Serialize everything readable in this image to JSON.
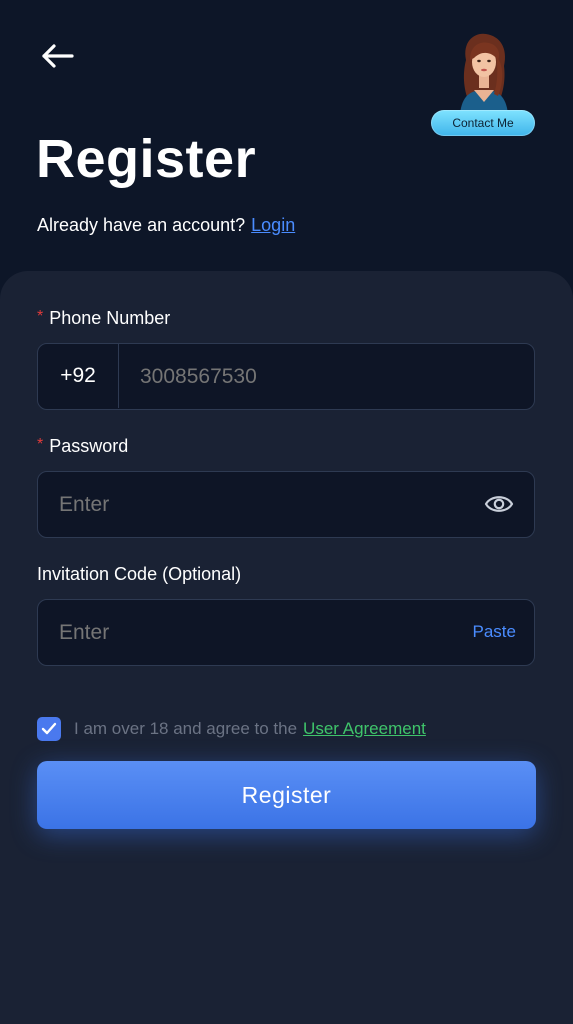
{
  "header": {
    "back_icon": "arrow-left-icon",
    "title": "Register",
    "have_account_text": "Already have an account?",
    "login_link": "Login"
  },
  "contact": {
    "label": "Contact Me"
  },
  "form": {
    "phone": {
      "label": "Phone Number",
      "required_mark": "*",
      "prefix": "+92",
      "placeholder": "3008567530"
    },
    "password": {
      "label": "Password",
      "required_mark": "*",
      "placeholder": "Enter",
      "toggle_icon": "eye-icon"
    },
    "invitation": {
      "label": "Invitation Code (Optional)",
      "placeholder": "Enter",
      "paste_label": "Paste"
    },
    "agreement": {
      "checked": true,
      "text": "I am over 18 and agree to the",
      "link": "User Agreement"
    },
    "submit_label": "Register"
  },
  "colors": {
    "background": "#0d1628",
    "card": "#1a2234",
    "accent_blue": "#4a8cff",
    "button": "#4a80ee",
    "link_green": "#3fc46a",
    "required_red": "#e23b3b"
  }
}
